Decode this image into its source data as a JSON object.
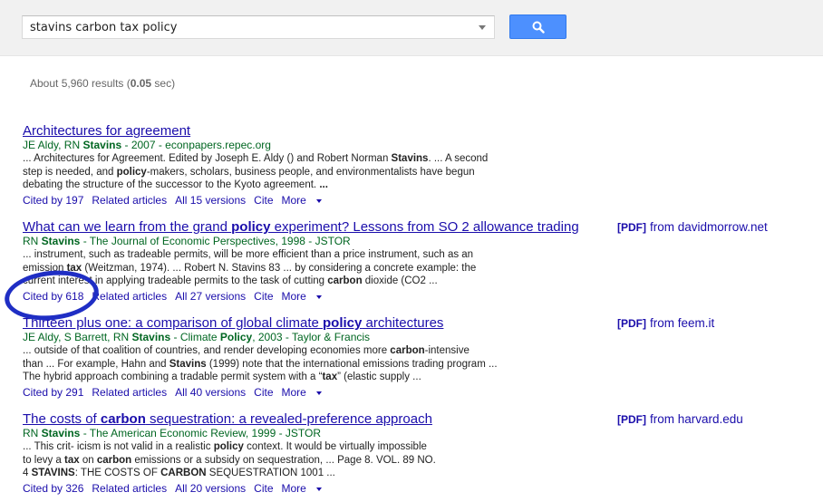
{
  "search": {
    "query": "stavins carbon tax policy"
  },
  "stats": {
    "prefix": "About 5,960 results (",
    "time": "0.05",
    "suffix": " sec)"
  },
  "results": [
    {
      "title": [
        "Architectures for agreement"
      ],
      "authors": [
        "JE Aldy, RN ",
        "Stavins",
        " - 2007 - econpapers.repec.org"
      ],
      "snippet": [
        [
          "... Architectures for Agreement. Edited by Joseph E. Aldy () and Robert Norman ",
          "Stavins",
          ". ... A second"
        ],
        [
          "step is needed, and ",
          "policy",
          "-makers, scholars, business people, and environmentalists have begun"
        ],
        [
          "debating the structure of the successor to the Kyoto agreement. ",
          "...",
          ""
        ]
      ],
      "links": [
        "Cited by 197",
        "Related articles",
        "All 15 versions",
        "Cite",
        "More"
      ]
    },
    {
      "title": [
        "What can we learn from the grand ",
        "policy",
        " experiment? Lessons from SO 2 allowance trading"
      ],
      "authors": [
        "RN ",
        "Stavins",
        " - The Journal of Economic Perspectives, 1998 - JSTOR"
      ],
      "snippet": [
        [
          "... instrument, such as tradeable permits, will be more efficient than a price instrument, such as an",
          "",
          ""
        ],
        [
          "emission ",
          "tax",
          " (Weitzman, 1974). ... Robert N. Stavins 83 ... by considering a concrete example: the"
        ],
        [
          "current interest in applying tradeable permits to the task of cutting ",
          "carbon",
          " dioxide (CO2 ..."
        ]
      ],
      "links": [
        "Cited by 618",
        "Related articles",
        "All 27 versions",
        "Cite",
        "More"
      ],
      "pdf": {
        "tag": "[PDF]",
        "source": "from davidmorrow.net"
      }
    },
    {
      "title": [
        "Thirteen plus one: a comparison of global climate ",
        "policy",
        " architectures"
      ],
      "authors": [
        "JE Aldy, S Barrett, RN ",
        "Stavins",
        " - Climate ",
        "Policy",
        ", 2003 - Taylor & Francis"
      ],
      "snippet": [
        [
          "... outside of that coalition of countries, and render developing economies more ",
          "carbon",
          "-intensive"
        ],
        [
          "than ... For example, Hahn and ",
          "Stavins",
          " (1999) note that the international emissions trading program ..."
        ],
        [
          "The hybrid approach combining a tradable permit system with a “",
          "tax",
          "” (elastic supply ..."
        ]
      ],
      "links": [
        "Cited by 291",
        "Related articles",
        "All 40 versions",
        "Cite",
        "More"
      ],
      "pdf": {
        "tag": "[PDF]",
        "source": "from feem.it"
      }
    },
    {
      "title": [
        "The costs of ",
        "carbon",
        " sequestration: a revealed-preference approach"
      ],
      "authors": [
        "RN ",
        "Stavins",
        " - The American Economic Review, 1999 - JSTOR"
      ],
      "snippet": [
        [
          "... This crit- icism is not valid in a realistic ",
          "policy",
          " context. It would be virtually impossible"
        ],
        [
          "to levy a ",
          "tax",
          " on ",
          "carbon",
          " emissions or a subsidy on sequestration, ... Page 8. VOL. 89 NO."
        ],
        [
          "4 ",
          "STAVINS",
          ": THE COSTS OF ",
          "CARBON",
          " SEQUESTRATION 1001 ..."
        ]
      ],
      "links": [
        "Cited by 326",
        "Related articles",
        "All 20 versions",
        "Cite",
        "More"
      ],
      "pdf": {
        "tag": "[PDF]",
        "source": "from harvard.edu"
      }
    }
  ],
  "colors": {
    "link": "#1a0dab",
    "green": "#006621",
    "annotation": "#1f2ec4",
    "button": "#4d90fe"
  },
  "icons": {
    "search_button": "magnifier-icon",
    "dropdown": "caret-down-icon"
  }
}
